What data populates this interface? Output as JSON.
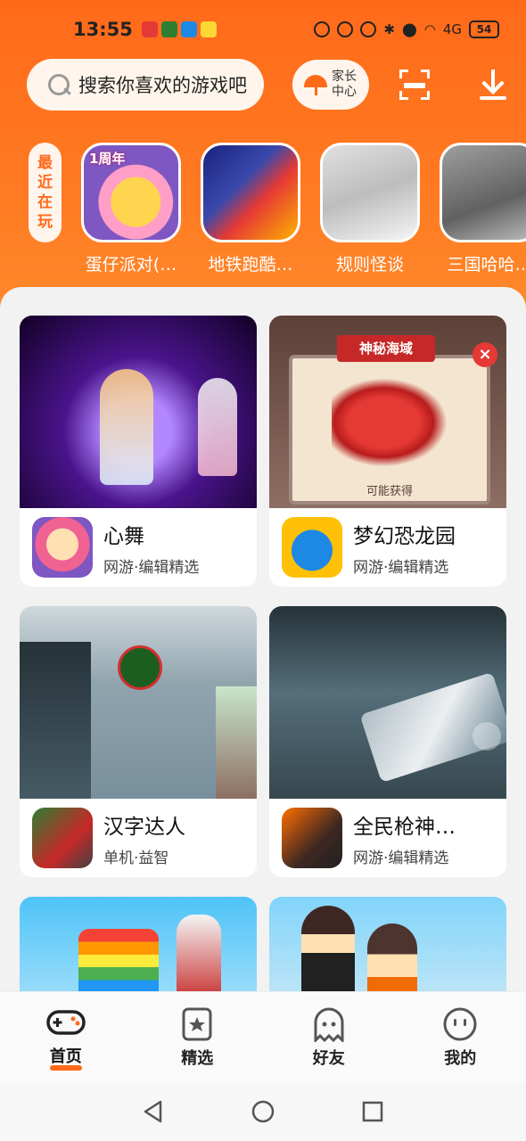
{
  "status": {
    "time": "13:55",
    "battery": "54",
    "network": "4G"
  },
  "search": {
    "placeholder": "搜索你喜欢的游戏吧"
  },
  "header": {
    "parent_label": "家长中心"
  },
  "recent": {
    "tag": "最近在玩",
    "items": [
      {
        "label": "蛋仔派对(…",
        "icon_text": "1周年"
      },
      {
        "label": "地铁跑酷…"
      },
      {
        "label": "规则怪谈"
      },
      {
        "label": "三国哈哈…"
      }
    ]
  },
  "cards": [
    {
      "title": "心舞",
      "subtitle": "网游·编辑精选"
    },
    {
      "title": "梦幻恐龙园",
      "subtitle": "网游·编辑精选",
      "image_text": "神秘海域",
      "image_caption": "可能获得"
    },
    {
      "title": "汉字达人",
      "subtitle": "单机·益智"
    },
    {
      "title": "全民枪神…",
      "subtitle": "网游·编辑精选"
    },
    {
      "title": "",
      "subtitle": ""
    },
    {
      "title": "",
      "subtitle": ""
    }
  ],
  "nav": {
    "items": [
      {
        "label": "首页",
        "icon": "gamepad-icon",
        "active": true
      },
      {
        "label": "精选",
        "icon": "star-bookmark-icon"
      },
      {
        "label": "好友",
        "icon": "ghost-icon"
      },
      {
        "label": "我的",
        "icon": "smile-face-icon"
      }
    ]
  },
  "colors": {
    "accent": "#ff6a1a",
    "sheet": "#f2f2f2"
  }
}
